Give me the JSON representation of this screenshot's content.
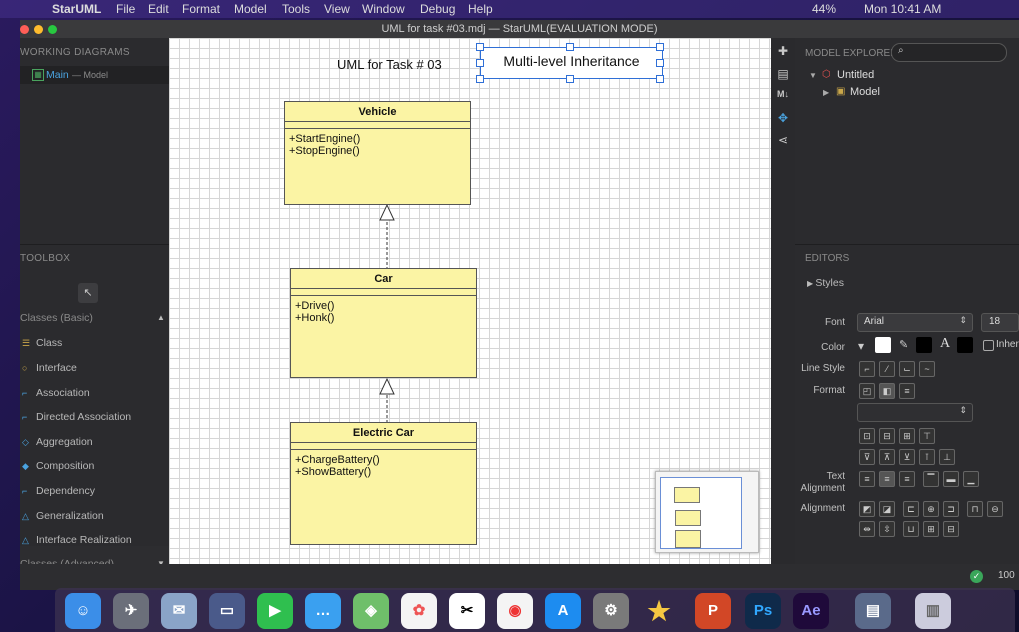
{
  "menubar": {
    "app": "StarUML",
    "items": [
      "File",
      "Edit",
      "Format",
      "Model",
      "Tools",
      "View",
      "Window",
      "Debug",
      "Help"
    ],
    "battery": "44%",
    "clock": "Mon 10:41 AM"
  },
  "window": {
    "title": "UML for task #03.mdj — StarUML(EVALUATION MODE)"
  },
  "working_diagrams": {
    "title": "WORKING DIAGRAMS",
    "item": "Main",
    "item_suffix": "— Model"
  },
  "toolbox": {
    "title": "TOOLBOX",
    "group_basic": "Classes (Basic)",
    "group_advanced": "Classes (Advanced)",
    "items": [
      "Class",
      "Interface",
      "Association",
      "Directed Association",
      "Aggregation",
      "Composition",
      "Dependency",
      "Generalization",
      "Interface Realization"
    ]
  },
  "diagram": {
    "caption": "UML for Task # 03",
    "title_box": "Multi-level Inheritance",
    "classes": [
      {
        "name": "Vehicle",
        "ops": [
          "+StartEngine()",
          "+StopEngine()"
        ]
      },
      {
        "name": "Car",
        "ops": [
          "+Drive()",
          "+Honk()"
        ]
      },
      {
        "name": "Electric Car",
        "ops": [
          "+ChargeBattery()",
          "+ShowBattery()"
        ]
      }
    ]
  },
  "model_explorer": {
    "title": "MODEL EXPLORER",
    "root": "Untitled",
    "child": "Model"
  },
  "editors": {
    "title": "EDITORS",
    "styles": "Styles",
    "font_label": "Font",
    "font_value": "Arial",
    "font_size": "18",
    "color_label": "Color",
    "inherit": "Inher",
    "line_style_label": "Line Style",
    "format_label": "Format",
    "text_align_label": "Text Alignment",
    "alignment_label": "Alignment"
  },
  "status": {
    "zoom": "100"
  },
  "colors": {
    "class_fill": "#fbf4a4",
    "accent": "#4aa3df",
    "selection": "#2f6fd6"
  }
}
